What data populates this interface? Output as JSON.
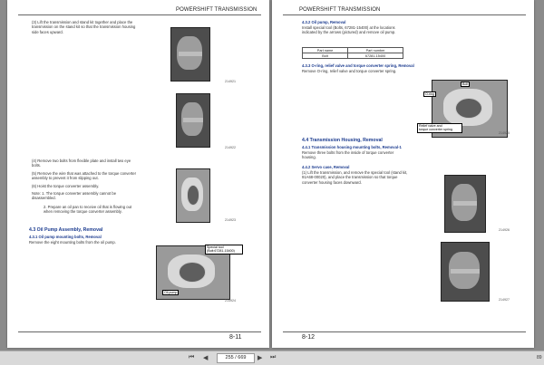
{
  "header_title": "POWERSHIFT TRANSMISSION",
  "left": {
    "step3": "(3) Lift the transmission and stand kit together and place the transmission on the stand kit so that the transmission housing side faces upward.",
    "fig1": "214921",
    "fig2": "214922",
    "step4": "(4) Remove two bolts from flexible plate and install two eye bolts.",
    "step5": "(5) Remove the wire that was attached to the torque converter assembly to prevent it from slipping out.",
    "step6": "(6) Hoist the torque converter assembly.",
    "note1": "Note: 1. The torque converter assembly cannot be disassembled.",
    "note2": "2. Prepare an oil pan to receive oil that is flowing out when removing the torque converter assembly.",
    "fig3": "214923",
    "sec43": "4.3  Oil Pump Assembly, Removal",
    "sec431": "4.3.1  Oil pump mounting bolts, Removal",
    "sec431_text": "Remove the eight mounting bolts from the oil pump.",
    "callout_tool": "Special tool\n(Bolt:67281-15400)",
    "callout_pump": "Oil pump",
    "fig4": "214924",
    "page_no": "8-11"
  },
  "right": {
    "sec432": "4.3.2  Oil pump, Removal",
    "sec432_text": "Install special tool (Bolts, 67281-15400) at the locations indicated by the arrows (pictured) and remove oil pump.",
    "table_headers": [
      "Part name",
      "Part number"
    ],
    "table_row": [
      "Bolt",
      "67281-15400"
    ],
    "sec433": "4.3.3  O-ring, relief valve and torque converter spring, Removal",
    "sec433_text": "Remove O-ring, relief valve and torque converter spring.",
    "callout_bolt": "Bolt",
    "callout_oring": "O-ring",
    "callout_relief": "Relief valve and\ntorque converter spring",
    "fig5": "214925",
    "sec44": "4.4  Transmission Housing, Removal",
    "sec441": "4.4.1  Transmission housing mounting bolts, Removal-1",
    "sec441_text": "Remove three bolts from the inside of torque converter housing.",
    "sec442": "4.4.2  Servo case, Removal",
    "sec442_text": "(1) Lift the transmission, and remove the special tool (stand kit, 91A68-00020), and place the transmission so that torque converter housing faces downward.",
    "fig6": "214926",
    "fig7": "214927",
    "page_no": "8-12"
  },
  "toolbar": {
    "first": "⏮",
    "prev": "◀",
    "page_value": "255 / 669",
    "next": "▶",
    "last": "⏭",
    "zoom": "89"
  }
}
